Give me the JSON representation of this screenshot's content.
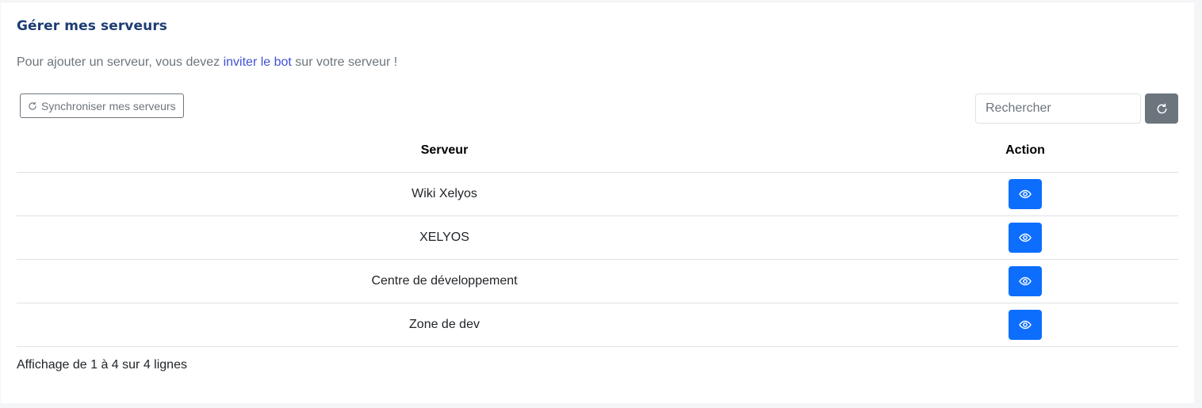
{
  "page": {
    "title": "Gérer mes serveurs",
    "intro_before": "Pour ajouter un serveur, vous devez ",
    "intro_link": "inviter le bot",
    "intro_after": " sur votre serveur !"
  },
  "toolbar": {
    "sync_label": "Synchroniser mes serveurs",
    "sync_icon": "refresh-icon",
    "search_placeholder": "Rechercher",
    "search_value": "",
    "refresh_icon": "refresh-icon"
  },
  "table": {
    "columns": [
      "Serveur",
      "Action"
    ],
    "rows": [
      {
        "name": "Wiki Xelyos",
        "action_icon": "eye-icon"
      },
      {
        "name": "XELYOS",
        "action_icon": "eye-icon"
      },
      {
        "name": "Centre de développement",
        "action_icon": "eye-icon"
      },
      {
        "name": "Zone de dev",
        "action_icon": "eye-icon"
      }
    ]
  },
  "pagination": {
    "info": "Affichage de 1 à 4 sur 4 lignes"
  },
  "colors": {
    "title": "#1c3d73",
    "link": "#3f51d7",
    "primary": "#0d6efd",
    "secondary": "#6c757d"
  }
}
